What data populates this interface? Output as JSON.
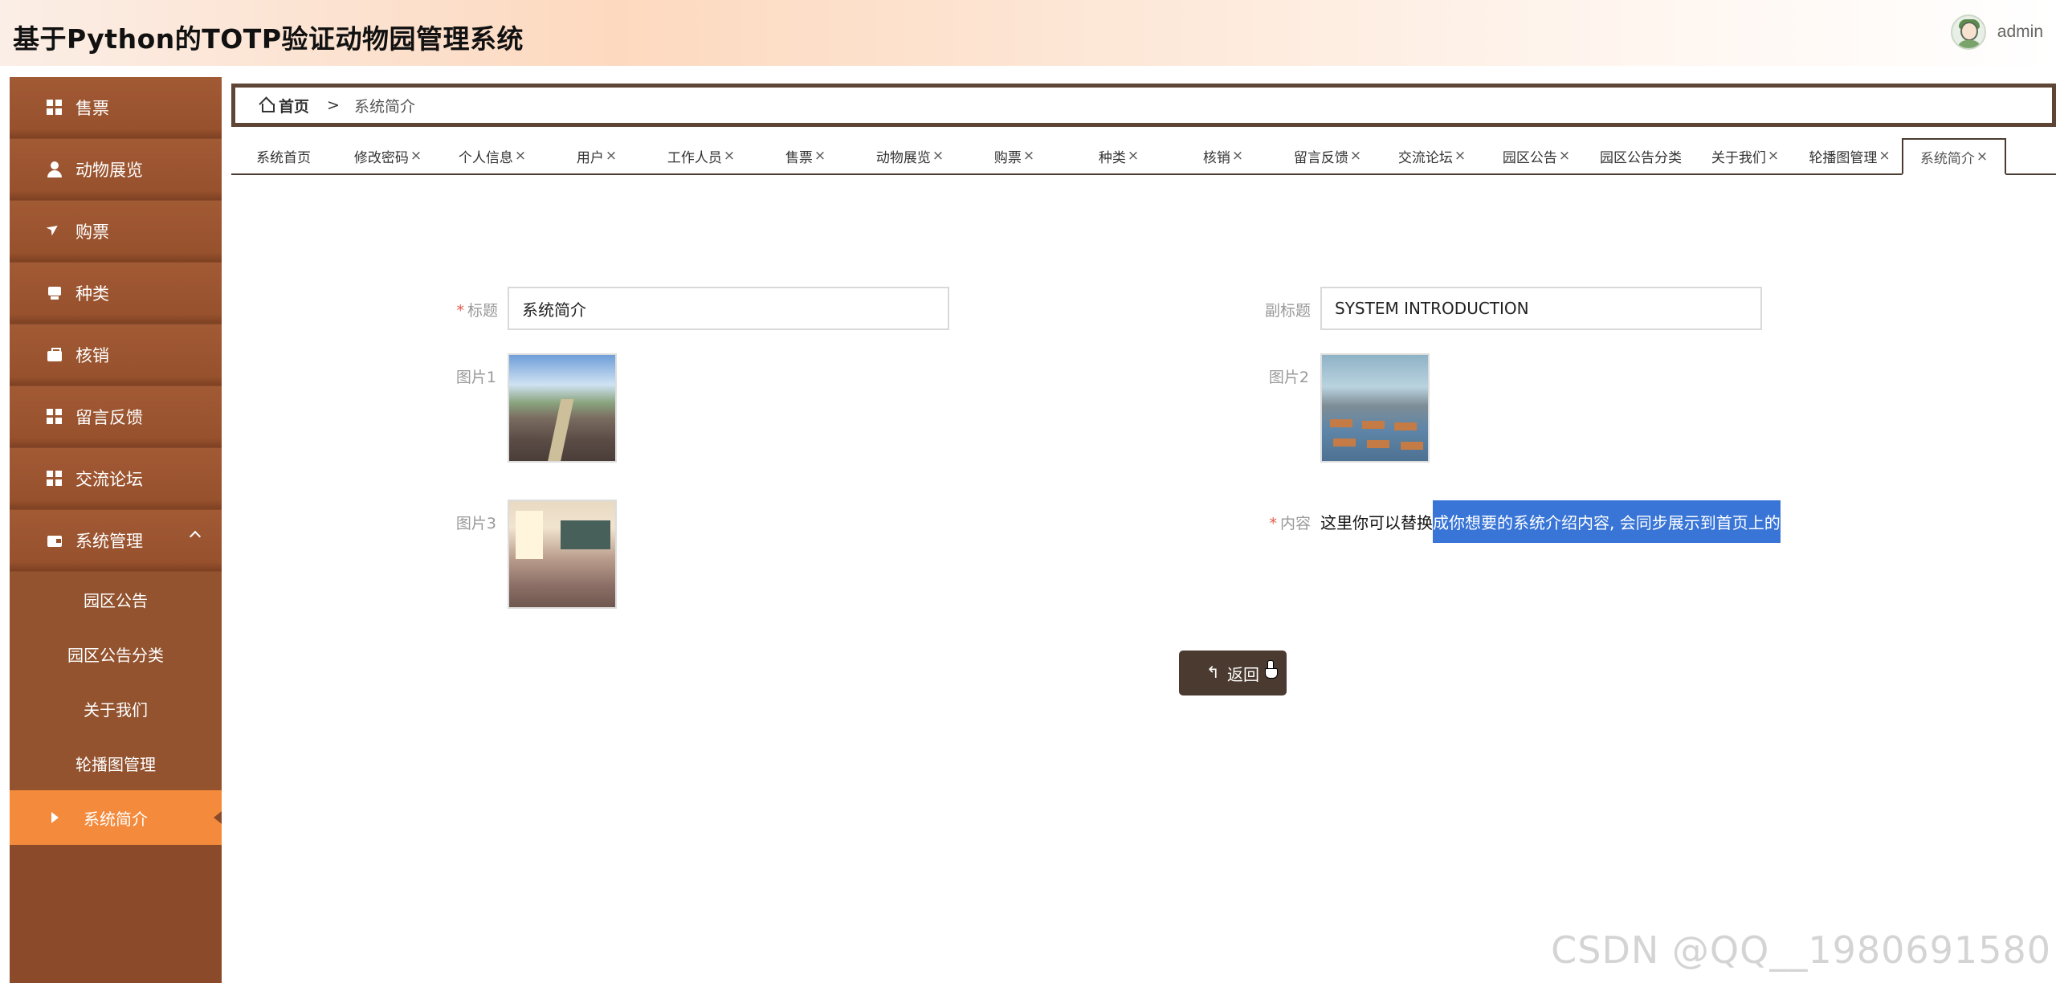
{
  "header": {
    "title": "基于Python的TOTP验证动物园管理系统",
    "username": "admin"
  },
  "sidebar": {
    "items": [
      {
        "label": "售票",
        "icon": "grid-icon"
      },
      {
        "label": "动物展览",
        "icon": "user-icon"
      },
      {
        "label": "购票",
        "icon": "send-icon"
      },
      {
        "label": "种类",
        "icon": "box-icon"
      },
      {
        "label": "核销",
        "icon": "briefcase-icon"
      },
      {
        "label": "留言反馈",
        "icon": "grid-icon"
      },
      {
        "label": "交流论坛",
        "icon": "grid-icon"
      },
      {
        "label": "系统管理",
        "icon": "wallet-icon"
      }
    ],
    "submenu": [
      {
        "label": "园区公告"
      },
      {
        "label": "园区公告分类"
      },
      {
        "label": "关于我们"
      },
      {
        "label": "轮播图管理"
      },
      {
        "label": "系统简介",
        "active": true
      }
    ]
  },
  "breadcrumb": {
    "home": "首页",
    "separator": ">",
    "current": "系统简介"
  },
  "tabs": [
    {
      "label": "系统首页",
      "closable": false
    },
    {
      "label": "修改密码",
      "closable": true
    },
    {
      "label": "个人信息",
      "closable": true
    },
    {
      "label": "用户",
      "closable": true
    },
    {
      "label": "工作人员",
      "closable": true
    },
    {
      "label": "售票",
      "closable": true
    },
    {
      "label": "动物展览",
      "closable": true
    },
    {
      "label": "购票",
      "closable": true
    },
    {
      "label": "种类",
      "closable": true
    },
    {
      "label": "核销",
      "closable": true
    },
    {
      "label": "留言反馈",
      "closable": true
    },
    {
      "label": "交流论坛",
      "closable": true
    },
    {
      "label": "园区公告",
      "closable": true
    },
    {
      "label": "园区公告分类",
      "closable": false
    },
    {
      "label": "关于我们",
      "closable": true
    },
    {
      "label": "轮播图管理",
      "closable": true
    },
    {
      "label": "系统简介",
      "closable": true,
      "active": true
    }
  ],
  "close_glyph": "×",
  "form": {
    "title_label": "标题",
    "title_value": "系统简介",
    "subtitle_label": "副标题",
    "subtitle_value": "SYSTEM INTRODUCTION",
    "image1_label": "图片1",
    "image2_label": "图片2",
    "image3_label": "图片3",
    "content_label": "内容",
    "content_plain": "这里你可以替换",
    "content_selected": "成你想要的系统介绍内容, 会同步展示到首页上的",
    "required_mark": "*"
  },
  "actions": {
    "back_label": "返回"
  },
  "watermark": "CSDN @QQ__1980691580",
  "colors": {
    "sidebar": "#97512d",
    "active_menu": "#f48a3c",
    "button": "#4a3a30",
    "selection": "#3875d7"
  }
}
